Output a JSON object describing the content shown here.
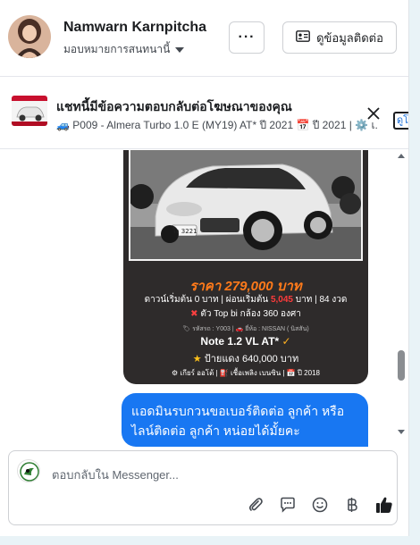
{
  "header": {
    "contact_name": "Namwarn Karnpitcha",
    "assignment": "มอบหมายการสนทนานี้",
    "more_label": "···",
    "contact_info_label": "ดูข้อมูลติดต่อ"
  },
  "banner": {
    "title": "แชทนี้มีข้อความตอบกลับต่อโฆษณาของคุณ",
    "subtitle": "🚙 P009 - Almera Turbo 1.0 E (MY19) AT* ปี 2021 📅 ปี 2021 | ⚙️ เ...",
    "link_label": "ดูโ"
  },
  "ad_card": {
    "plate": "ใจ 3221",
    "price": "ราคา 279,000 บาท",
    "terms_prefix": "ดาวน์เริ่มต้น 0 บาท | ผ่อนเริ่มต้น ",
    "terms_amount": "5,045",
    "terms_suffix": " บาท | 84 งวด",
    "feature_mark": "✖",
    "feature": " ตัว Top bi กล้อง 360 องศา",
    "codes": "🏷 รหัสรถ : Y003 | 🚗 ยี่ห้อ : NISSAN ( นิสสัน)",
    "model": "Note 1.2 VL AT*",
    "model_check": " ✓",
    "redplate_star": "★",
    "redplate": " ป้ายแดง 640,000 บาท",
    "specs": "⚙ เกียร์ ออโต้  |  ⛽ เชื้อเพลิง เบนซิน  |  📅 ปี 2018"
  },
  "message": {
    "text": "แอดมินรบกวนขอเบอร์ติดต่อ ลูกค้า หรือ ไลน์ติดต่อ ลูกค้า  หน่อยได้มั้ยคะ"
  },
  "composer": {
    "placeholder": "ตอบกลับใน Messenger...",
    "tools": [
      "paperclip-icon",
      "saved-reply-icon",
      "emoji-icon",
      "baht-icon",
      "like-icon"
    ]
  },
  "colors": {
    "accent": "#1877f2",
    "price": "#ff7a1a",
    "card_bg": "#2e2b2b"
  }
}
